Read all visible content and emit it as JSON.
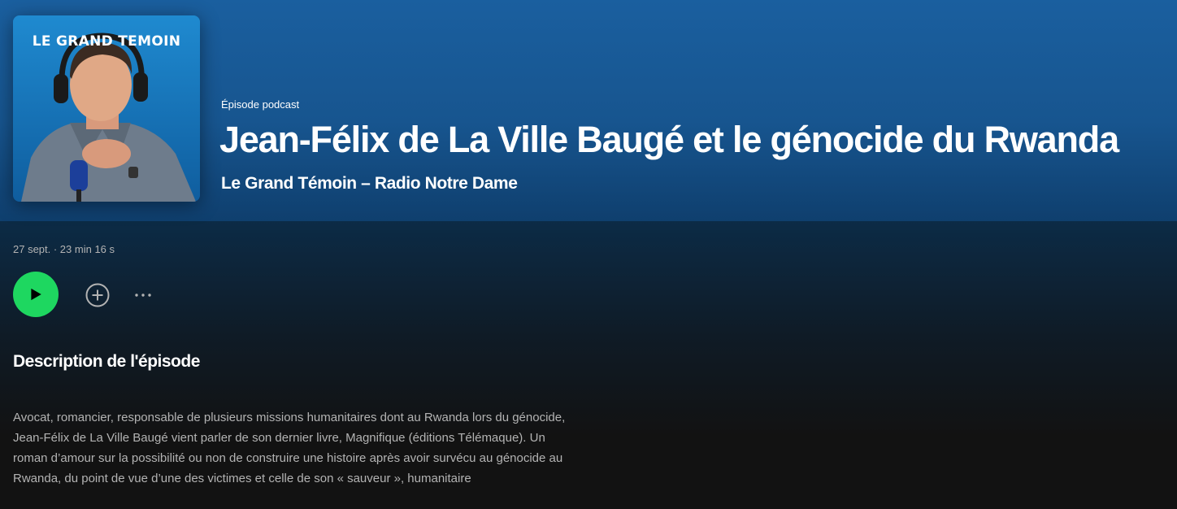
{
  "cover": {
    "title": "LE GRAND TEMOIN"
  },
  "episode": {
    "type_label": "Épisode podcast",
    "title": "Jean-Félix de La Ville Baugé et le génocide du Rwanda",
    "show": "Le Grand Témoin – Radio Notre Dame",
    "meta": "27 sept. · 23 min 16 s"
  },
  "actions": {
    "play_icon": "play-icon",
    "add_icon": "plus-circle-icon",
    "more_icon": "more-horizontal-icon"
  },
  "description": {
    "heading": "Description de l'épisode",
    "text": "Avocat, romancier, responsable de plusieurs missions humanitaires dont au Rwanda lors du génocide, Jean-Félix de La Ville Baugé vient parler de son dernier livre, Magnifique (éditions Télémaque). Un roman d’amour sur la possibilité ou non de construire une histoire après avoir survécu au génocide au Rwanda, du point de vue d’une des victimes et celle de son « sauveur », humanitaire"
  },
  "colors": {
    "accent": "#1ed760",
    "hero": "#17558f",
    "background": "#121212",
    "subdued_text": "#b3b3b3"
  }
}
